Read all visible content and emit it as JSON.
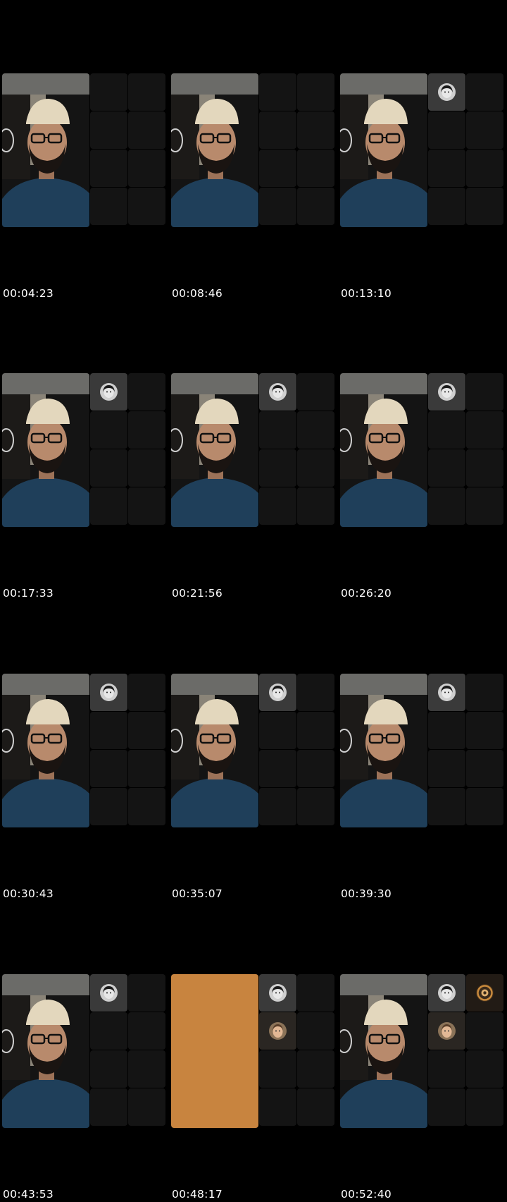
{
  "frames": [
    {
      "time": "00:04:23",
      "video": "person",
      "participants": []
    },
    {
      "time": "00:08:46",
      "video": "person",
      "participants": []
    },
    {
      "time": "00:13:10",
      "video": "person",
      "participants": [
        "avatar-bw"
      ]
    },
    {
      "time": "00:17:33",
      "video": "person",
      "participants": [
        "avatar-bw"
      ]
    },
    {
      "time": "00:21:56",
      "video": "person",
      "participants": [
        "avatar-bw"
      ]
    },
    {
      "time": "00:26:20",
      "video": "person",
      "participants": [
        "avatar-bw"
      ]
    },
    {
      "time": "00:30:43",
      "video": "person",
      "participants": [
        "avatar-bw"
      ]
    },
    {
      "time": "00:35:07",
      "video": "person",
      "participants": [
        "avatar-bw"
      ]
    },
    {
      "time": "00:39:30",
      "video": "person",
      "participants": [
        "avatar-bw"
      ]
    },
    {
      "time": "00:43:53",
      "video": "person",
      "participants": [
        "avatar-bw"
      ]
    },
    {
      "time": "00:48:17",
      "video": "orange",
      "participants": [
        "avatar-bw",
        "avatar-face"
      ]
    },
    {
      "time": "00:52:40",
      "video": "person",
      "participants": [
        "avatar-bw",
        "avatar-face",
        "avatar-gold"
      ]
    }
  ],
  "colors": {
    "background": "#000000",
    "tile": "#141414",
    "host_tile": "#3a3a3a",
    "shirt": "#1f3f5a",
    "cap": "#e3d7bd",
    "orange_video": "#c8843f"
  }
}
